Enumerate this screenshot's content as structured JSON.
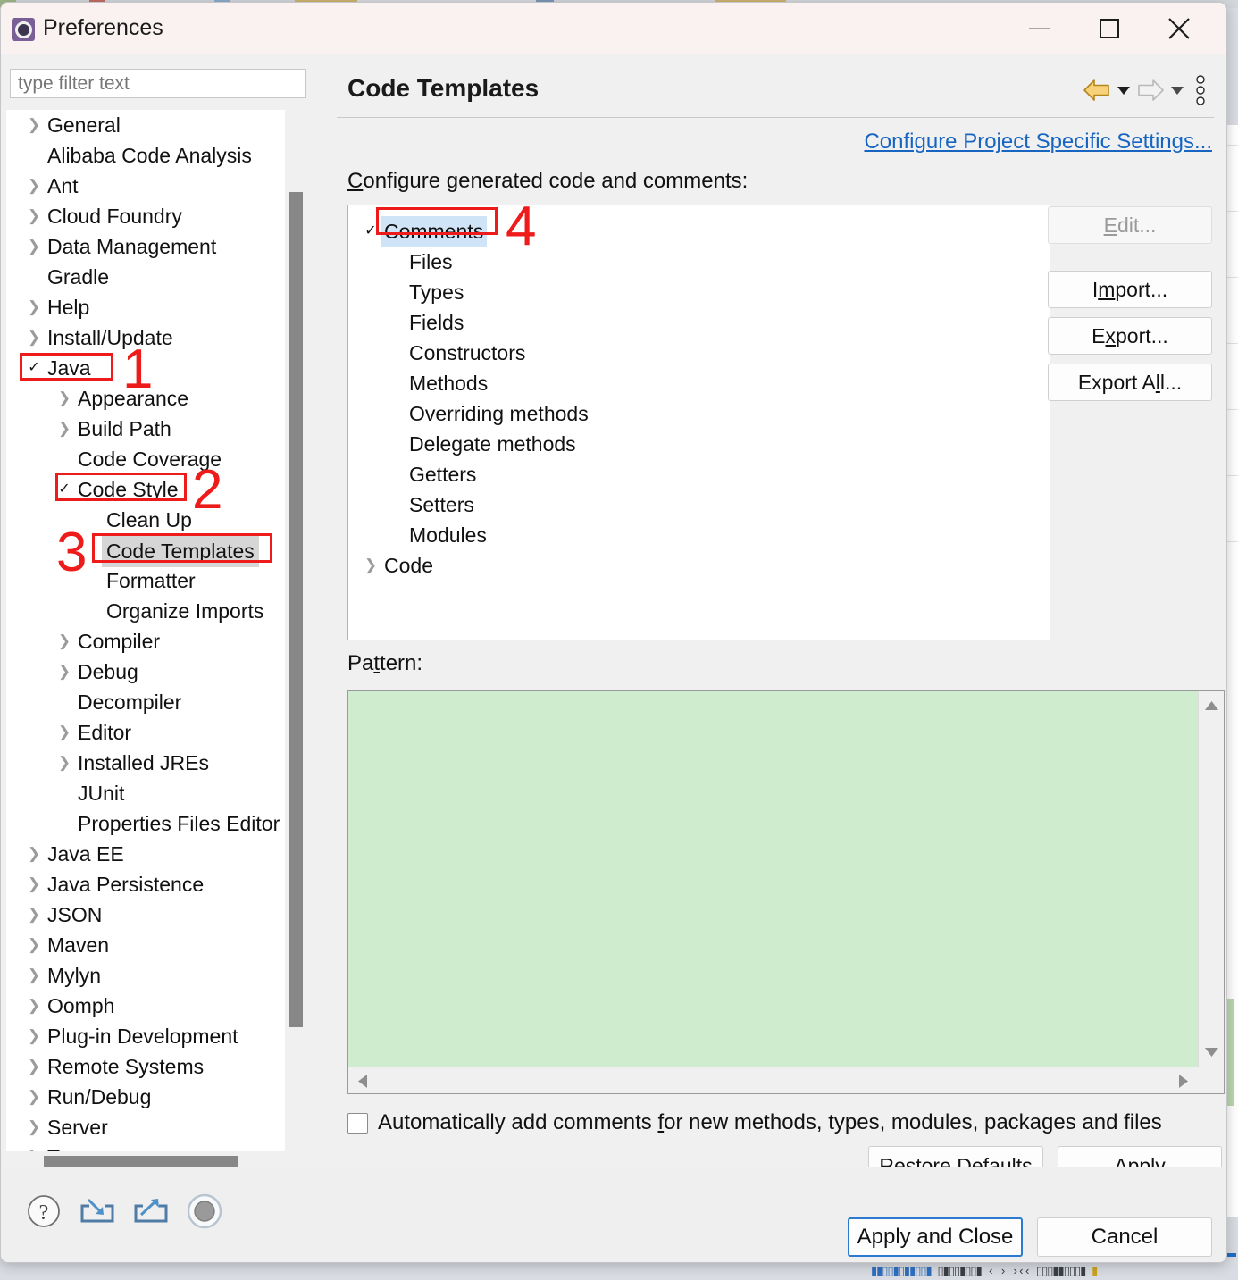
{
  "window": {
    "title": "Preferences",
    "icon": "preferences-gear-icon",
    "controls": {
      "minimize": "minimize-icon",
      "maximize": "maximize-icon",
      "close": "close-icon"
    }
  },
  "sidebar": {
    "filter": {
      "placeholder": "type filter text",
      "value": ""
    },
    "items": [
      {
        "label": "General",
        "level": 0,
        "twisty": "collapsed"
      },
      {
        "label": "Alibaba Code Analysis",
        "level": 0,
        "twisty": "none"
      },
      {
        "label": "Ant",
        "level": 0,
        "twisty": "collapsed"
      },
      {
        "label": "Cloud Foundry",
        "level": 0,
        "twisty": "collapsed"
      },
      {
        "label": "Data Management",
        "level": 0,
        "twisty": "collapsed"
      },
      {
        "label": "Gradle",
        "level": 0,
        "twisty": "none"
      },
      {
        "label": "Help",
        "level": 0,
        "twisty": "collapsed"
      },
      {
        "label": "Install/Update",
        "level": 0,
        "twisty": "collapsed"
      },
      {
        "label": "Java",
        "level": 0,
        "twisty": "expanded"
      },
      {
        "label": "Appearance",
        "level": 1,
        "twisty": "collapsed"
      },
      {
        "label": "Build Path",
        "level": 1,
        "twisty": "collapsed"
      },
      {
        "label": "Code Coverage",
        "level": 1,
        "twisty": "none"
      },
      {
        "label": "Code Style",
        "level": 1,
        "twisty": "expanded"
      },
      {
        "label": "Clean Up",
        "level": 2,
        "twisty": "none"
      },
      {
        "label": "Code Templates",
        "level": 2,
        "twisty": "none",
        "selected": true
      },
      {
        "label": "Formatter",
        "level": 2,
        "twisty": "none"
      },
      {
        "label": "Organize Imports",
        "level": 2,
        "twisty": "none"
      },
      {
        "label": "Compiler",
        "level": 1,
        "twisty": "collapsed"
      },
      {
        "label": "Debug",
        "level": 1,
        "twisty": "collapsed"
      },
      {
        "label": "Decompiler",
        "level": 1,
        "twisty": "none"
      },
      {
        "label": "Editor",
        "level": 1,
        "twisty": "collapsed"
      },
      {
        "label": "Installed JREs",
        "level": 1,
        "twisty": "collapsed"
      },
      {
        "label": "JUnit",
        "level": 1,
        "twisty": "none"
      },
      {
        "label": "Properties Files Editor",
        "level": 1,
        "twisty": "none"
      },
      {
        "label": "Java EE",
        "level": 0,
        "twisty": "collapsed"
      },
      {
        "label": "Java Persistence",
        "level": 0,
        "twisty": "collapsed"
      },
      {
        "label": "JSON",
        "level": 0,
        "twisty": "collapsed"
      },
      {
        "label": "Maven",
        "level": 0,
        "twisty": "collapsed"
      },
      {
        "label": "Mylyn",
        "level": 0,
        "twisty": "collapsed"
      },
      {
        "label": "Oomph",
        "level": 0,
        "twisty": "collapsed"
      },
      {
        "label": "Plug-in Development",
        "level": 0,
        "twisty": "collapsed"
      },
      {
        "label": "Remote Systems",
        "level": 0,
        "twisty": "collapsed"
      },
      {
        "label": "Run/Debug",
        "level": 0,
        "twisty": "collapsed"
      },
      {
        "label": "Server",
        "level": 0,
        "twisty": "collapsed"
      },
      {
        "label": "Team",
        "level": 0,
        "twisty": "collapsed"
      }
    ]
  },
  "page": {
    "title": "Code Templates",
    "nav": {
      "back": "back-arrow-icon",
      "forward": "forward-arrow-icon",
      "menu": "view-menu-icon"
    },
    "project_specific_link": "Configure Project Specific Settings...",
    "configure_label_prefix": "C",
    "configure_label_rest": "onfigure generated code and comments:",
    "template_tree": [
      {
        "label": "Comments",
        "level": 0,
        "twisty": "expanded",
        "selected": true
      },
      {
        "label": "Files",
        "level": 1,
        "twisty": "none"
      },
      {
        "label": "Types",
        "level": 1,
        "twisty": "none"
      },
      {
        "label": "Fields",
        "level": 1,
        "twisty": "none"
      },
      {
        "label": "Constructors",
        "level": 1,
        "twisty": "none"
      },
      {
        "label": "Methods",
        "level": 1,
        "twisty": "none"
      },
      {
        "label": "Overriding methods",
        "level": 1,
        "twisty": "none"
      },
      {
        "label": "Delegate methods",
        "level": 1,
        "twisty": "none"
      },
      {
        "label": "Getters",
        "level": 1,
        "twisty": "none"
      },
      {
        "label": "Setters",
        "level": 1,
        "twisty": "none"
      },
      {
        "label": "Modules",
        "level": 1,
        "twisty": "none"
      },
      {
        "label": "Code",
        "level": 0,
        "twisty": "collapsed"
      }
    ],
    "buttons": {
      "edit": {
        "pre": "",
        "mn": "E",
        "post": "dit...",
        "disabled": true
      },
      "import": {
        "pre": "I",
        "mn": "m",
        "post": "port..."
      },
      "export": {
        "pre": "E",
        "mn": "x",
        "post": "port..."
      },
      "export_all": {
        "pre": "Export A",
        "mn": "l",
        "post": "l..."
      }
    },
    "pattern": {
      "label_pre": "Pa",
      "label_mn": "t",
      "label_post": "tern:",
      "value": "",
      "background_color": "#cfeccf"
    },
    "auto_comments": {
      "checked": false,
      "label_pre": "Automatically add comments ",
      "label_mn": "f",
      "label_post": "or new methods, types, modules, packages and files"
    },
    "restore_defaults": {
      "pre": "Restore ",
      "mn": "D",
      "post": "efaults"
    },
    "apply": {
      "pre": "",
      "mn": "A",
      "post": "pply"
    }
  },
  "footer": {
    "icons": [
      "help-icon",
      "import-preferences-icon",
      "export-preferences-icon",
      "status-circle-icon"
    ],
    "apply_and_close": "Apply and Close",
    "cancel": "Cancel"
  },
  "annotations": [
    {
      "number": "1",
      "target": "Java"
    },
    {
      "number": "2",
      "target": "Code Style"
    },
    {
      "number": "3",
      "target": "Code Templates"
    },
    {
      "number": "4",
      "target": "Comments"
    }
  ],
  "colors": {
    "annotation_red": "#ee1b1b",
    "link_blue": "#1765c1",
    "pattern_green": "#cfeccf",
    "selection_blue": "#cfe4f7",
    "selection_grey": "#d6d6d6",
    "focus_blue": "#2b7ad1"
  }
}
